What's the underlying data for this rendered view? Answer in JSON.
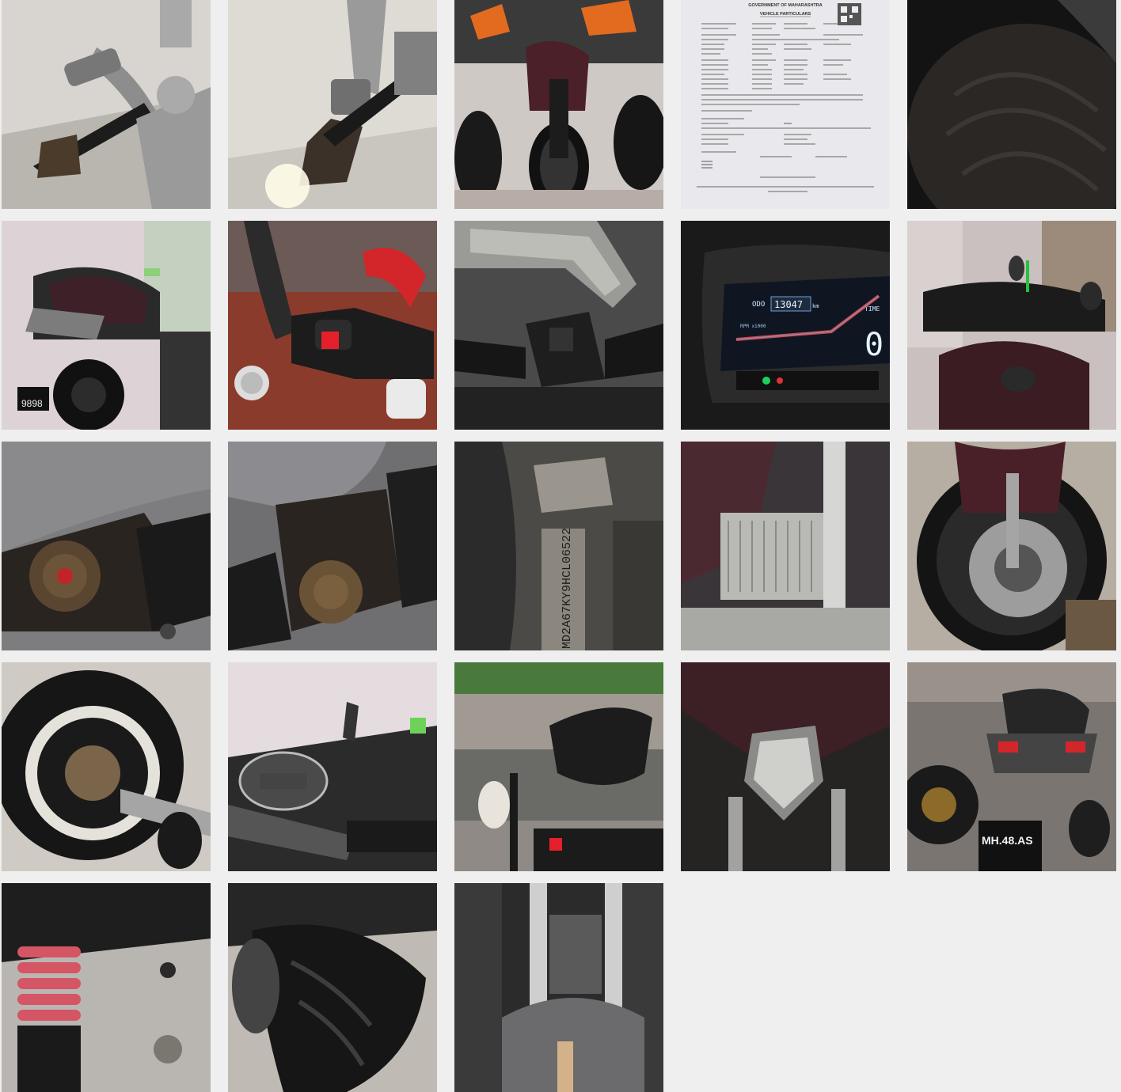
{
  "gallery": {
    "document": {
      "header": "GOVERNMENT OF MAHARASHTRA",
      "subheader": "VEHICLE PARTICULARS"
    },
    "odometer": {
      "odo_label": "ODO",
      "odo_value": "13047",
      "odo_unit": "km",
      "time_label": "TIME",
      "speed": "0",
      "rpm_label": "RPM x1000"
    },
    "frame_number": "MD2A67KY9HCL06522",
    "plate_text": "MH.48.AS"
  }
}
